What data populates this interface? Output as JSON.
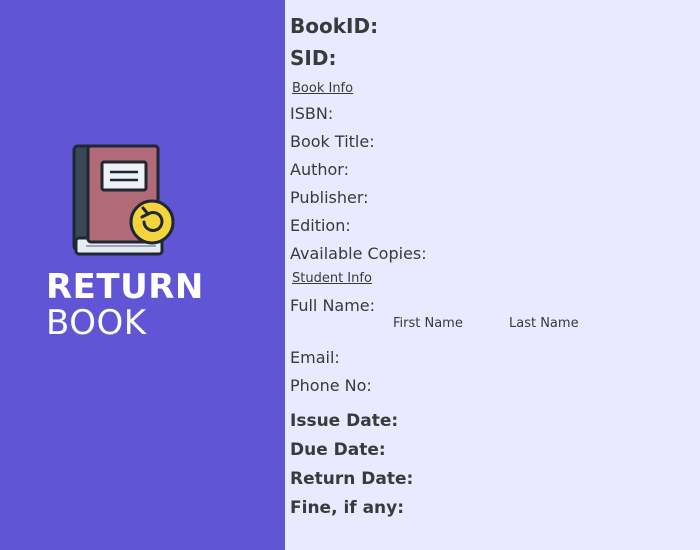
{
  "sidebar": {
    "heading_line1": "RETURN",
    "heading_line2": "BOOK",
    "icon": "book-return-icon"
  },
  "form": {
    "book_id_label": "BookID:",
    "sid_label": "SID:",
    "book_info_section": "Book Info",
    "isbn_label": "ISBN:",
    "book_title_label": "Book Title:",
    "author_label": "Author:",
    "publisher_label": "Publisher:",
    "edition_label": "Edition:",
    "available_copies_label": "Available Copies:",
    "student_info_section": "Student Info",
    "full_name_label": "Full Name:",
    "first_name_label": "First Name",
    "last_name_label": "Last Name",
    "email_label": "Email:",
    "phone_label": "Phone No:",
    "issue_date_label": "Issue Date:",
    "due_date_label": "Due Date:",
    "return_date_label": "Return Date:",
    "fine_label": "Fine, if any:"
  },
  "colors": {
    "sidebar_bg": "#6055d4",
    "content_bg": "#e9e9ff",
    "text": "#3a3a3a"
  }
}
